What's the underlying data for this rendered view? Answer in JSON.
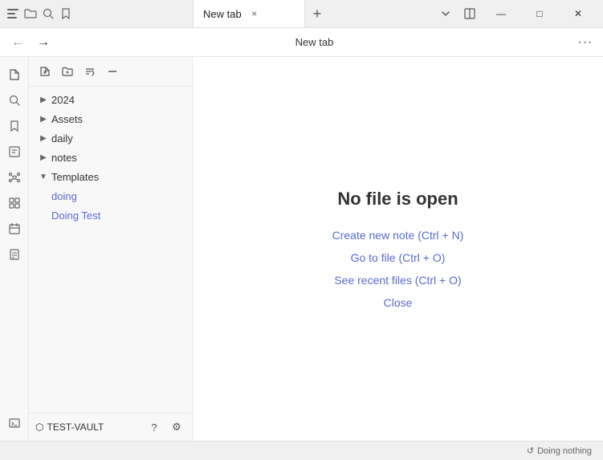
{
  "titleBar": {
    "windowIcon": "☰",
    "tab": {
      "title": "New tab",
      "closeLabel": "×"
    },
    "newTabLabel": "+",
    "buttons": {
      "dropdown": "⌄",
      "split": "⊟",
      "minimize": "—",
      "maximize": "□",
      "close": "✕"
    }
  },
  "addressBar": {
    "backLabel": "←",
    "forwardLabel": "→",
    "title": "New tab",
    "moreLabel": "···"
  },
  "sidebarIcons": [
    {
      "name": "files-icon",
      "icon": "🗂",
      "label": "Files"
    },
    {
      "name": "search-icon",
      "icon": "⌕",
      "label": "Search"
    },
    {
      "name": "bookmark-icon",
      "icon": "⊡",
      "label": "Bookmarks"
    },
    {
      "name": "note-icon",
      "icon": "⟨%⟩",
      "label": "Note"
    },
    {
      "name": "graph-icon",
      "icon": "⋮",
      "label": "Graph"
    },
    {
      "name": "widgets-icon",
      "icon": "⊞",
      "label": "Widgets"
    },
    {
      "name": "calendar-icon",
      "icon": "⊟",
      "label": "Calendar"
    },
    {
      "name": "pages-icon",
      "icon": "⊡",
      "label": "Pages"
    },
    {
      "name": "terminal-icon",
      "icon": ">_",
      "label": "Terminal"
    }
  ],
  "filePanel": {
    "toolbar": {
      "newNote": "✎",
      "newFolder": "⊕",
      "sort": "⇅",
      "collapse": "✕"
    },
    "treeItems": [
      {
        "id": "2024",
        "label": "2024",
        "type": "folder",
        "expanded": false
      },
      {
        "id": "assets",
        "label": "Assets",
        "type": "folder",
        "expanded": false
      },
      {
        "id": "daily",
        "label": "daily",
        "type": "folder",
        "expanded": false
      },
      {
        "id": "notes",
        "label": "notes",
        "type": "folder",
        "expanded": false
      },
      {
        "id": "templates",
        "label": "Templates",
        "type": "folder",
        "expanded": true
      },
      {
        "id": "doing",
        "label": "doing",
        "type": "file"
      },
      {
        "id": "doing-test",
        "label": "Doing Test",
        "type": "file"
      }
    ],
    "footer": {
      "vaultLabel": "TEST-VAULT",
      "vaultIcon": "⬡",
      "helpLabel": "?",
      "settingsLabel": "⚙"
    }
  },
  "editor": {
    "noFileTitle": "No file is open",
    "links": [
      {
        "id": "create-new",
        "label": "Create new note (Ctrl + N)"
      },
      {
        "id": "go-to-file",
        "label": "Go to file (Ctrl + O)"
      },
      {
        "id": "recent-files",
        "label": "See recent files (Ctrl + O)"
      },
      {
        "id": "close",
        "label": "Close"
      }
    ]
  },
  "statusBar": {
    "icon": "↺",
    "label": "Doing nothing"
  }
}
